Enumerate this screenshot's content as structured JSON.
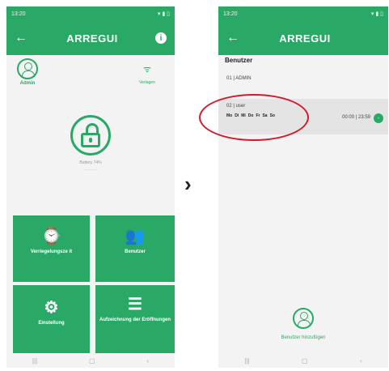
{
  "left_screen": {
    "status_time": "13:20",
    "status_right": "▾ ▮ ▯",
    "app_title": "ARREGUI",
    "back_icon": "←",
    "info_icon": "i",
    "admin_label": "Admin",
    "wifi_label": "Verlagen",
    "battery_label": "Battery 74%",
    "battery_sub": "————",
    "tiles": [
      {
        "label": "Verriegelungsze it",
        "icon": "tablet-clock-icon"
      },
      {
        "label": "Benutzer",
        "icon": "users-icon"
      },
      {
        "label": "Einstellung",
        "icon": "gear-icon"
      },
      {
        "label": "Aufzeichnung der Eröffnungen",
        "icon": "list-icon"
      }
    ],
    "nav": [
      "|||",
      "▢",
      "‹"
    ]
  },
  "right_screen": {
    "status_time": "13:20",
    "status_right": "▾ ▮ ▯",
    "app_title": "ARREGUI",
    "back_icon": "←",
    "section_title": "Benutzer",
    "users": [
      {
        "name": "01 | ADMIN"
      },
      {
        "name": "02 | user",
        "days": [
          "Mo",
          "Di",
          "Mi",
          "Do",
          "Fr",
          "Sa",
          "So"
        ],
        "time": "00:00 | 23:59",
        "delete_icon": "-"
      }
    ],
    "add_user_label": "Benutzer hinzufügen",
    "nav": [
      "|||",
      "▢",
      "‹"
    ]
  },
  "transition_arrow": "›",
  "colors": {
    "accent": "#2aa966",
    "highlight": "#d11a2a"
  }
}
